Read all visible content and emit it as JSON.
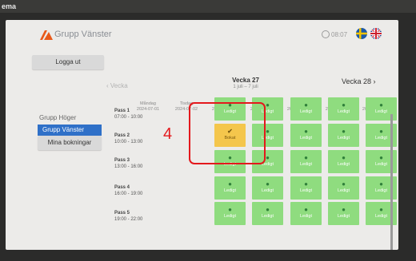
{
  "corner_label": "ema",
  "header": {
    "title": "Grupp Vänster",
    "clock": "08:07"
  },
  "sidebar": {
    "logout_label": "Logga ut",
    "group_label": "Grupp Höger",
    "active_group": "Grupp Vänster",
    "my_bookings_label": "Mina bokningar"
  },
  "nav": {
    "prev_label": "Vecka",
    "current_week": "Vecka 27",
    "current_range": "1 juli – 7 juli",
    "next_label": "Vecka 28"
  },
  "days": [
    {
      "name": "Måndag",
      "date": "2024-07-01"
    },
    {
      "name": "Tisdag",
      "date": "2024-07-02"
    },
    {
      "name": "Onsdag",
      "date": "2024-07-03"
    },
    {
      "name": "Torsdag",
      "date": "2024-07-04"
    },
    {
      "name": "Fredag",
      "date": "2024-07-05"
    },
    {
      "name": "Lördag",
      "date": "2024-07-06"
    },
    {
      "name": "Söndag",
      "date": "2024-07-07"
    }
  ],
  "passes": [
    {
      "name": "Pass 1",
      "time": "07:00 - 10:00"
    },
    {
      "name": "Pass 2",
      "time": "10:00 - 13:00"
    },
    {
      "name": "Pass 3",
      "time": "13:00 - 16:00"
    },
    {
      "name": "Pass 4",
      "time": "16:00 - 19:00"
    },
    {
      "name": "Pass 5",
      "time": "19:00 - 22:00"
    }
  ],
  "slot_labels": {
    "free": "Ledigt",
    "booked": "Bokat"
  },
  "annotation": {
    "number": "4"
  },
  "colors": {
    "free": "#8fdc7f",
    "booked": "#f4c64c",
    "accent": "#2f70c8",
    "highlight": "#e4181c"
  }
}
